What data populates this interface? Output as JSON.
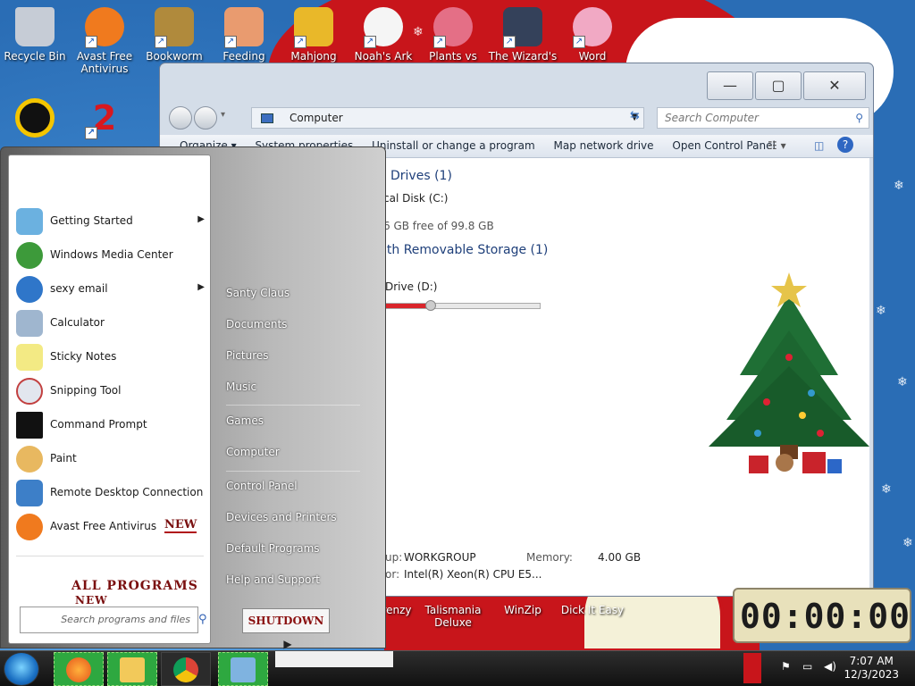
{
  "desktop": {
    "icons": [
      {
        "label": "Recycle Bin",
        "color": "#c6ccd6"
      },
      {
        "label": "Avast Free Antivirus",
        "color": "#f07a1e"
      },
      {
        "label": "Bookworm",
        "color": "#b08a3c"
      },
      {
        "label": "Feeding",
        "color": "#e99b6f"
      },
      {
        "label": "Mahjong",
        "color": "#e9b829"
      },
      {
        "label": "Noah's Ark",
        "color": "#f5f5f5"
      },
      {
        "label": "Plants vs",
        "color": "#e46f86"
      },
      {
        "label": "The Wizard's",
        "color": "#34415a"
      },
      {
        "label": "Word",
        "color": "#f1a9c4"
      }
    ],
    "bottom_icons": [
      {
        "label": "renzy"
      },
      {
        "label": "Talismania Deluxe"
      },
      {
        "label": "WinZip"
      },
      {
        "label": "Dick It Easy"
      }
    ]
  },
  "window": {
    "address": "Computer",
    "search_placeholder": "Search Computer",
    "toolbar": [
      "Organize",
      "System properties",
      "Uninstall or change a program",
      "Map network drive",
      "Open Control Panel"
    ],
    "sections": {
      "drives": "Drives (1)",
      "removable": "ith Removable Storage (1)"
    },
    "local_disk": "cal Disk (C:)",
    "disk_free": "6 GB free of 99.8 GB",
    "disk_used_fraction": 0.3,
    "dvd": "Drive (D:)",
    "workgroup_label": "up:",
    "workgroup": "WORKGROUP",
    "memory_label": "Memory:",
    "memory": "4.00 GB",
    "processor_label": "or:",
    "processor": "Intel(R) Xeon(R) CPU E5..."
  },
  "start_menu": {
    "programs": [
      {
        "label": "Getting Started",
        "arrow": true,
        "icon": "getting-started",
        "color": "#6bb1e0"
      },
      {
        "label": "Windows Media Center",
        "arrow": false,
        "icon": "media-center",
        "color": "#3d9a3a"
      },
      {
        "label": "sexy email",
        "arrow": true,
        "icon": "thunderbird",
        "color": "#2f76c9"
      },
      {
        "label": "Calculator",
        "arrow": false,
        "icon": "calculator",
        "color": "#9fb6cf"
      },
      {
        "label": "Sticky Notes",
        "arrow": false,
        "icon": "sticky-notes",
        "color": "#f3ea84"
      },
      {
        "label": "Snipping Tool",
        "arrow": false,
        "icon": "snipping-tool",
        "color": "#c24040"
      },
      {
        "label": "Command Prompt",
        "arrow": false,
        "icon": "cmd",
        "color": "#111111"
      },
      {
        "label": "Paint",
        "arrow": false,
        "icon": "paint",
        "color": "#e8b860"
      },
      {
        "label": "Remote Desktop Connection",
        "arrow": false,
        "icon": "remote-desktop",
        "color": "#3d7fc8"
      },
      {
        "label": "Avast Free Antivirus",
        "arrow": false,
        "icon": "avast",
        "color": "#f07a1e"
      }
    ],
    "new_tag": "NEW",
    "all_programs": "ALL PROGRAMS",
    "search_placeholder": "Search programs and files",
    "right_items": [
      "Santy Claus",
      "Documents",
      "Pictures",
      "Music",
      "Games",
      "Computer",
      "Control Panel",
      "Devices and Printers",
      "Default Programs",
      "Help and Support"
    ],
    "shutdown": "SHUTDOWN"
  },
  "gadget": {
    "time": "00:00:00"
  },
  "taskbar": {
    "time": "7:07 AM",
    "date": "12/3/2023"
  }
}
